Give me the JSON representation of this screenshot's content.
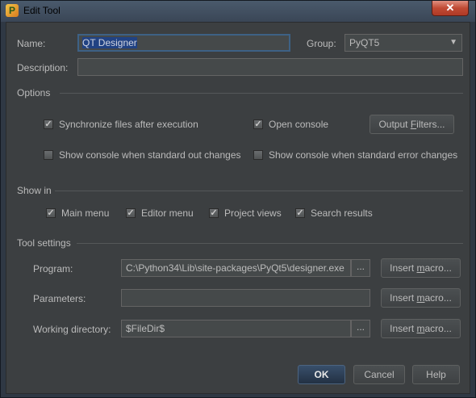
{
  "window": {
    "title": "Edit Tool",
    "close_glyph": "✕"
  },
  "fields": {
    "name_label": "Name:",
    "name_value": "QT Designer",
    "group_label": "Group:",
    "group_value": "PyQT5",
    "description_label": "Description:",
    "description_value": ""
  },
  "options": {
    "section_title": "Options",
    "sync_files": {
      "label": "Synchronize files after execution",
      "checked": true
    },
    "open_console": {
      "label": "Open console",
      "checked": true
    },
    "output_filters_button": {
      "pre": "Output ",
      "key": "F",
      "post": "ilters..."
    },
    "show_console_stdout": {
      "label": "Show console when standard out changes",
      "checked": false
    },
    "show_console_stderr": {
      "label": "Show console when standard error changes",
      "checked": false
    }
  },
  "show_in": {
    "section_title": "Show in",
    "main_menu": {
      "label": "Main menu",
      "checked": true
    },
    "editor_menu": {
      "label": "Editor menu",
      "checked": true
    },
    "project_views": {
      "label": "Project views",
      "checked": true
    },
    "search_results": {
      "label": "Search results",
      "checked": true
    }
  },
  "tool_settings": {
    "section_title": "Tool settings",
    "program_label": "Program:",
    "program_value": "C:\\Python34\\Lib\\site-packages\\PyQt5\\designer.exe",
    "parameters_label": "Parameters:",
    "parameters_value": "",
    "working_dir_label": "Working directory:",
    "working_dir_value": "$FileDir$",
    "browse_label": "...",
    "insert_macro": {
      "pre": "Insert ",
      "key": "m",
      "post": "acro..."
    }
  },
  "footer": {
    "ok_label": "OK",
    "cancel_label": "Cancel",
    "help_label": "Help"
  },
  "icons": {
    "check_glyph": "✓",
    "dropdown_glyph": "▼",
    "app_icon": "pycharm-icon"
  }
}
